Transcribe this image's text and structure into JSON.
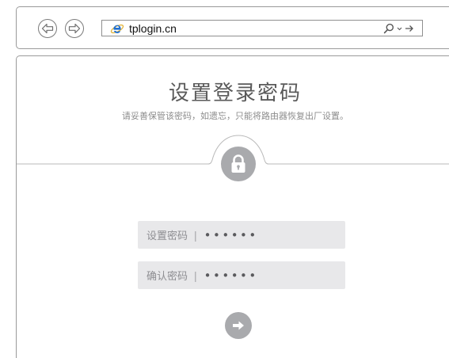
{
  "browser": {
    "url": "tplogin.cn",
    "icons": {
      "back": "back-arrow-icon",
      "forward": "forward-arrow-icon",
      "site": "ie-icon",
      "search": "search-icon",
      "dropdown": "chevron-down-icon",
      "go": "arrow-right-icon"
    }
  },
  "page": {
    "title": "设置登录密码",
    "subtitle": "请妥善保管该密码，如遗忘，只能将路由器恢复出厂设置。",
    "lock_icon": "lock-icon",
    "fields": [
      {
        "label": "设置密码",
        "separator": "|",
        "value": "••••••"
      },
      {
        "label": "确认密码",
        "separator": "|",
        "value": "••••••"
      }
    ],
    "submit_icon": "arrow-right-icon"
  },
  "colors": {
    "accent_grey": "#a9aaad",
    "field_bg": "#e8e8ea",
    "title_text": "#5a5a5a",
    "subtitle_text": "#8c8c8c",
    "ie_blue": "#1f6fd1"
  }
}
